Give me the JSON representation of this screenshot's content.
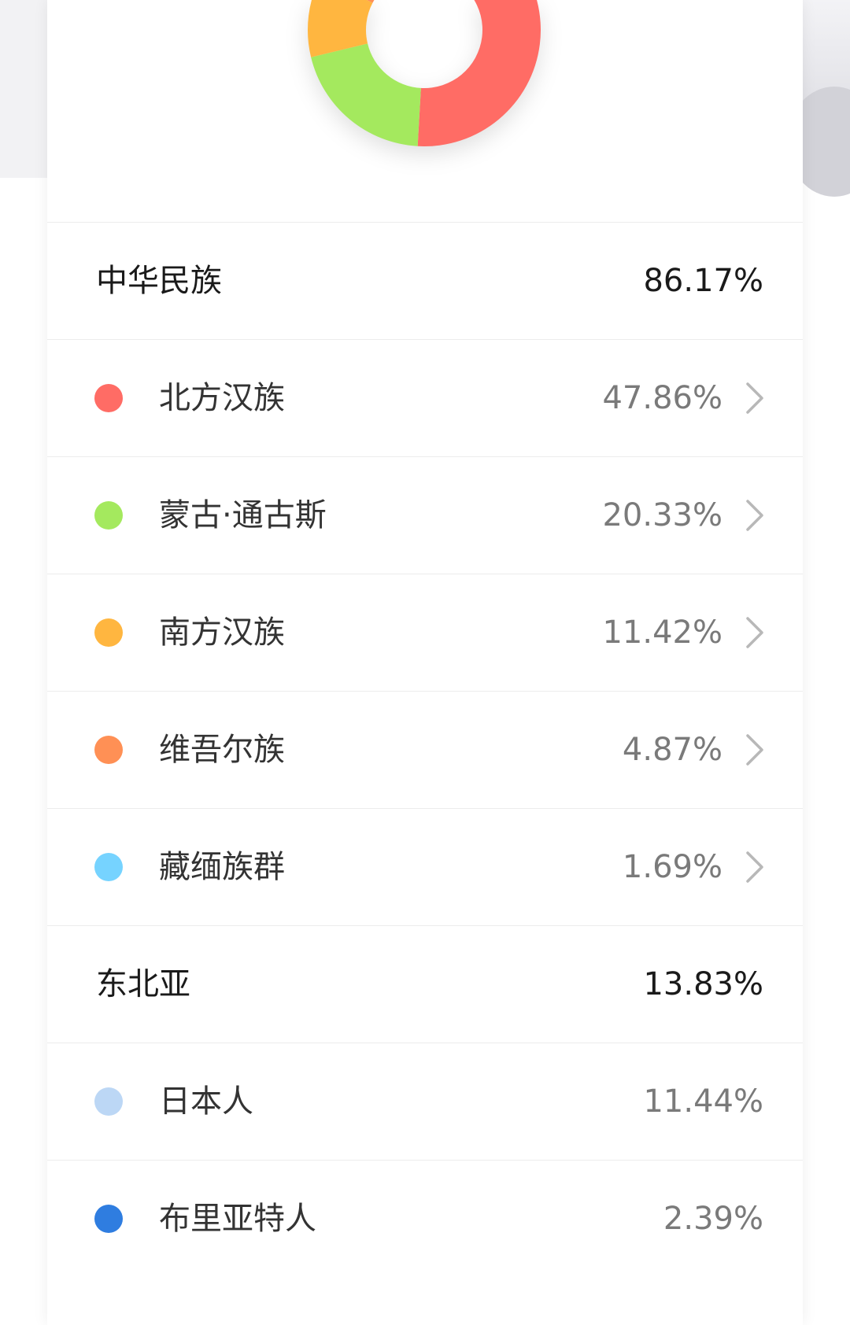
{
  "chart_data": {
    "type": "pie",
    "donut": true,
    "categories": [
      "北方汉族",
      "蒙古·通古斯",
      "南方汉族",
      "维吾尔族",
      "藏缅族群",
      "日本人",
      "布里亚特人"
    ],
    "values": [
      47.86,
      20.33,
      11.42,
      4.87,
      1.69,
      11.44,
      2.39
    ],
    "colors": [
      "#ff6c65",
      "#a4e95e",
      "#ffb640",
      "#ff9055",
      "#76d3ff",
      "#bcd7f5",
      "#2f7de0"
    ],
    "title": ""
  },
  "rows": [
    {
      "kind": "header",
      "name": "中华民族",
      "percent": "86.17%"
    },
    {
      "kind": "sub",
      "name": "北方汉族",
      "percent": "47.86%",
      "color": "#ff6c65",
      "chevron": true
    },
    {
      "kind": "sub",
      "name": "蒙古·通古斯",
      "percent": "20.33%",
      "color": "#a4e95e",
      "chevron": true
    },
    {
      "kind": "sub",
      "name": "南方汉族",
      "percent": "11.42%",
      "color": "#ffb640",
      "chevron": true
    },
    {
      "kind": "sub",
      "name": "维吾尔族",
      "percent": "4.87%",
      "color": "#ff9055",
      "chevron": true
    },
    {
      "kind": "sub",
      "name": "藏缅族群",
      "percent": "1.69%",
      "color": "#76d3ff",
      "chevron": true
    },
    {
      "kind": "header",
      "name": "东北亚",
      "percent": "13.83%"
    },
    {
      "kind": "sub",
      "name": "日本人",
      "percent": "11.44%",
      "color": "#bcd7f5",
      "chevron": false
    },
    {
      "kind": "sub",
      "name": "布里亚特人",
      "percent": "2.39%",
      "color": "#2f7de0",
      "chevron": false
    }
  ],
  "icons": {
    "chevron": "chevron-right-icon"
  }
}
